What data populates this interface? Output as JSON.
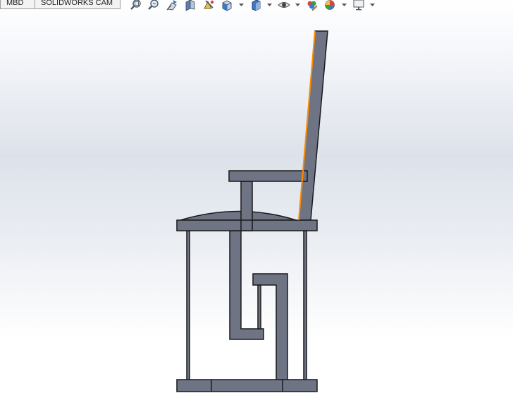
{
  "tabs": [
    {
      "label": "MBD"
    },
    {
      "label": "SOLIDWORKS CAM"
    }
  ],
  "heads_up_toolbar": [
    {
      "icon": "zoom-to-fit-icon"
    },
    {
      "icon": "zoom-to-area-icon"
    },
    {
      "icon": "previous-view-icon"
    },
    {
      "icon": "section-view-icon"
    },
    {
      "icon": "dynamic-annotation-views-icon"
    },
    {
      "icon": "view-orientation-icon",
      "dropdown": true
    },
    {
      "icon": "display-style-icon",
      "dropdown": true
    },
    {
      "icon": "hide-show-items-icon",
      "dropdown": true
    },
    {
      "icon": "edit-appearance-icon"
    },
    {
      "icon": "apply-scene-icon",
      "dropdown": true
    },
    {
      "icon": "view-settings-icon",
      "dropdown": true
    }
  ],
  "colors": {
    "part_fill": "#6f7485",
    "part_edge": "#1a1a1a",
    "selected_edge": "#ff8c00",
    "viewport_bg_top": "#ffffff",
    "viewport_bg_mid": "#dde2ea"
  },
  "model": {
    "name": "chair",
    "view": "side",
    "selected_feature": "backrest front edge"
  }
}
